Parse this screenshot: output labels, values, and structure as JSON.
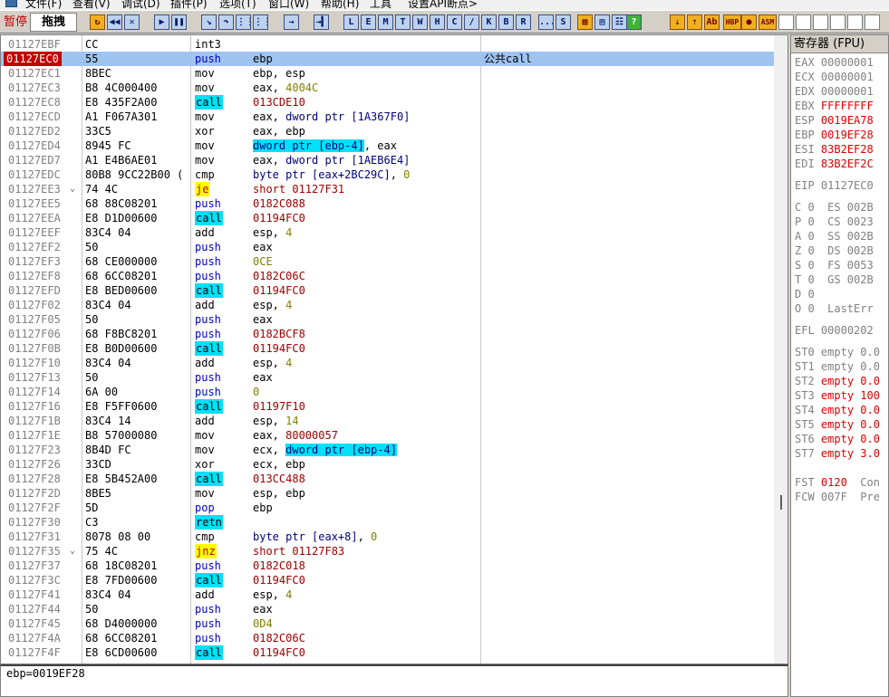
{
  "menu": [
    "文件(F)",
    "查看(V)",
    "调试(D)",
    "插件(P)",
    "选项(T)",
    "窗口(W)",
    "帮助(H)",
    "工具",
    "设置API断点>"
  ],
  "toolbar": {
    "status": "暂停",
    "module": "拖拽",
    "letters": [
      "L",
      "E",
      "M",
      "T",
      "W",
      "H",
      "C",
      "/",
      "K",
      "B",
      "R",
      "...",
      "S"
    ],
    "right_tools": [
      "HBP",
      "ASM"
    ]
  },
  "disasm": [
    {
      "addr": "01127EBF",
      "hex": "CC",
      "mn": "int3",
      "ops": [],
      "cm": "",
      "kind": "",
      "sel": false,
      "marker": ""
    },
    {
      "addr": "01127EC0",
      "hex": "55",
      "mn": "push",
      "ops": [
        {
          "t": "ebp"
        }
      ],
      "cm": "公共call",
      "kind": "push",
      "sel": true,
      "marker": ""
    },
    {
      "addr": "01127EC1",
      "hex": "8BEC",
      "mn": "mov",
      "ops": [
        {
          "t": "ebp, esp"
        }
      ],
      "cm": "",
      "kind": "",
      "sel": false,
      "marker": ""
    },
    {
      "addr": "01127EC3",
      "hex": "B8 4C000400",
      "mn": "mov",
      "ops": [
        {
          "t": "eax, "
        },
        {
          "t": "4004C",
          "c": "num"
        }
      ],
      "cm": "",
      "kind": "",
      "sel": false,
      "marker": ""
    },
    {
      "addr": "01127EC8",
      "hex": "E8 435F2A00",
      "mn": "call",
      "ops": [
        {
          "t": "013CDE10",
          "c": "addr"
        }
      ],
      "cm": "",
      "kind": "call",
      "sel": false,
      "marker": ""
    },
    {
      "addr": "01127ECD",
      "hex": "A1 F067A301",
      "mn": "mov",
      "ops": [
        {
          "t": "eax, "
        },
        {
          "t": "dword ptr [1A367F0]",
          "c": "mem"
        }
      ],
      "cm": "",
      "kind": "",
      "sel": false,
      "marker": ""
    },
    {
      "addr": "01127ED2",
      "hex": "33C5",
      "mn": "xor",
      "ops": [
        {
          "t": "eax, ebp"
        }
      ],
      "cm": "",
      "kind": "",
      "sel": false,
      "marker": ""
    },
    {
      "addr": "01127ED4",
      "hex": "8945 FC",
      "mn": "mov",
      "ops": [
        {
          "t": "dword ptr [ebp-4]",
          "c": "memhl"
        },
        {
          "t": ", eax"
        }
      ],
      "cm": "",
      "kind": "",
      "sel": false,
      "marker": ""
    },
    {
      "addr": "01127ED7",
      "hex": "A1 E4B6AE01",
      "mn": "mov",
      "ops": [
        {
          "t": "eax, "
        },
        {
          "t": "dword ptr [1AEB6E4]",
          "c": "mem"
        }
      ],
      "cm": "",
      "kind": "",
      "sel": false,
      "marker": ""
    },
    {
      "addr": "01127EDC",
      "hex": "80B8 9CC22B00 (",
      "mn": "cmp",
      "ops": [
        {
          "t": "byte ptr [eax+2BC29C]",
          "c": "mem"
        },
        {
          "t": ", "
        },
        {
          "t": "0",
          "c": "num"
        }
      ],
      "cm": "",
      "kind": "",
      "sel": false,
      "marker": ""
    },
    {
      "addr": "01127EE3",
      "hex": "74 4C",
      "mn": "je",
      "ops": [
        {
          "t": "short 01127F31",
          "c": "addr"
        }
      ],
      "cm": "",
      "kind": "jmp",
      "sel": false,
      "marker": "⌄"
    },
    {
      "addr": "01127EE5",
      "hex": "68 88C08201",
      "mn": "push",
      "ops": [
        {
          "t": "0182C088",
          "c": "addr"
        }
      ],
      "cm": "",
      "kind": "push",
      "sel": false,
      "marker": ""
    },
    {
      "addr": "01127EEA",
      "hex": "E8 D1D00600",
      "mn": "call",
      "ops": [
        {
          "t": "01194FC0",
          "c": "addr"
        }
      ],
      "cm": "",
      "kind": "call",
      "sel": false,
      "marker": ""
    },
    {
      "addr": "01127EEF",
      "hex": "83C4 04",
      "mn": "add",
      "ops": [
        {
          "t": "esp, "
        },
        {
          "t": "4",
          "c": "num"
        }
      ],
      "cm": "",
      "kind": "",
      "sel": false,
      "marker": ""
    },
    {
      "addr": "01127EF2",
      "hex": "50",
      "mn": "push",
      "ops": [
        {
          "t": "eax"
        }
      ],
      "cm": "",
      "kind": "push",
      "sel": false,
      "marker": ""
    },
    {
      "addr": "01127EF3",
      "hex": "68 CE000000",
      "mn": "push",
      "ops": [
        {
          "t": "0CE",
          "c": "num"
        }
      ],
      "cm": "",
      "kind": "push",
      "sel": false,
      "marker": ""
    },
    {
      "addr": "01127EF8",
      "hex": "68 6CC08201",
      "mn": "push",
      "ops": [
        {
          "t": "0182C06C",
          "c": "addr"
        }
      ],
      "cm": "",
      "kind": "push",
      "sel": false,
      "marker": ""
    },
    {
      "addr": "01127EFD",
      "hex": "E8 BED00600",
      "mn": "call",
      "ops": [
        {
          "t": "01194FC0",
          "c": "addr"
        }
      ],
      "cm": "",
      "kind": "call",
      "sel": false,
      "marker": ""
    },
    {
      "addr": "01127F02",
      "hex": "83C4 04",
      "mn": "add",
      "ops": [
        {
          "t": "esp, "
        },
        {
          "t": "4",
          "c": "num"
        }
      ],
      "cm": "",
      "kind": "",
      "sel": false,
      "marker": ""
    },
    {
      "addr": "01127F05",
      "hex": "50",
      "mn": "push",
      "ops": [
        {
          "t": "eax"
        }
      ],
      "cm": "",
      "kind": "push",
      "sel": false,
      "marker": ""
    },
    {
      "addr": "01127F06",
      "hex": "68 F8BC8201",
      "mn": "push",
      "ops": [
        {
          "t": "0182BCF8",
          "c": "addr"
        }
      ],
      "cm": "",
      "kind": "push",
      "sel": false,
      "marker": ""
    },
    {
      "addr": "01127F0B",
      "hex": "E8 B0D00600",
      "mn": "call",
      "ops": [
        {
          "t": "01194FC0",
          "c": "addr"
        }
      ],
      "cm": "",
      "kind": "call",
      "sel": false,
      "marker": ""
    },
    {
      "addr": "01127F10",
      "hex": "83C4 04",
      "mn": "add",
      "ops": [
        {
          "t": "esp, "
        },
        {
          "t": "4",
          "c": "num"
        }
      ],
      "cm": "",
      "kind": "",
      "sel": false,
      "marker": ""
    },
    {
      "addr": "01127F13",
      "hex": "50",
      "mn": "push",
      "ops": [
        {
          "t": "eax"
        }
      ],
      "cm": "",
      "kind": "push",
      "sel": false,
      "marker": ""
    },
    {
      "addr": "01127F14",
      "hex": "6A 00",
      "mn": "push",
      "ops": [
        {
          "t": "0",
          "c": "num"
        }
      ],
      "cm": "",
      "kind": "push",
      "sel": false,
      "marker": ""
    },
    {
      "addr": "01127F16",
      "hex": "E8 F5FF0600",
      "mn": "call",
      "ops": [
        {
          "t": "01197F10",
          "c": "addr"
        }
      ],
      "cm": "",
      "kind": "call",
      "sel": false,
      "marker": ""
    },
    {
      "addr": "01127F1B",
      "hex": "83C4 14",
      "mn": "add",
      "ops": [
        {
          "t": "esp, "
        },
        {
          "t": "14",
          "c": "num"
        }
      ],
      "cm": "",
      "kind": "",
      "sel": false,
      "marker": ""
    },
    {
      "addr": "01127F1E",
      "hex": "B8 57000080",
      "mn": "mov",
      "ops": [
        {
          "t": "eax, "
        },
        {
          "t": "80000057",
          "c": "addr"
        }
      ],
      "cm": "",
      "kind": "",
      "sel": false,
      "marker": ""
    },
    {
      "addr": "01127F23",
      "hex": "8B4D FC",
      "mn": "mov",
      "ops": [
        {
          "t": "ecx, "
        },
        {
          "t": "dword ptr [ebp-4]",
          "c": "memhl"
        }
      ],
      "cm": "",
      "kind": "",
      "sel": false,
      "marker": ""
    },
    {
      "addr": "01127F26",
      "hex": "33CD",
      "mn": "xor",
      "ops": [
        {
          "t": "ecx, ebp"
        }
      ],
      "cm": "",
      "kind": "",
      "sel": false,
      "marker": ""
    },
    {
      "addr": "01127F28",
      "hex": "E8 5B452A00",
      "mn": "call",
      "ops": [
        {
          "t": "013CC488",
          "c": "addr"
        }
      ],
      "cm": "",
      "kind": "call",
      "sel": false,
      "marker": ""
    },
    {
      "addr": "01127F2D",
      "hex": "8BE5",
      "mn": "mov",
      "ops": [
        {
          "t": "esp, ebp"
        }
      ],
      "cm": "",
      "kind": "",
      "sel": false,
      "marker": ""
    },
    {
      "addr": "01127F2F",
      "hex": "5D",
      "mn": "pop",
      "ops": [
        {
          "t": "ebp"
        }
      ],
      "cm": "",
      "kind": "pop",
      "sel": false,
      "marker": ""
    },
    {
      "addr": "01127F30",
      "hex": "C3",
      "mn": "retn",
      "ops": [],
      "cm": "",
      "kind": "ret",
      "sel": false,
      "marker": ""
    },
    {
      "addr": "01127F31",
      "hex": "8078 08 00",
      "mn": "cmp",
      "ops": [
        {
          "t": "byte ptr [eax+8]",
          "c": "mem"
        },
        {
          "t": ", "
        },
        {
          "t": "0",
          "c": "num"
        }
      ],
      "cm": "",
      "kind": "",
      "sel": false,
      "marker": ""
    },
    {
      "addr": "01127F35",
      "hex": "75 4C",
      "mn": "jnz",
      "ops": [
        {
          "t": "short 01127F83",
          "c": "addr"
        }
      ],
      "cm": "",
      "kind": "jmp",
      "sel": false,
      "marker": "⌄"
    },
    {
      "addr": "01127F37",
      "hex": "68 18C08201",
      "mn": "push",
      "ops": [
        {
          "t": "0182C018",
          "c": "addr"
        }
      ],
      "cm": "",
      "kind": "push",
      "sel": false,
      "marker": ""
    },
    {
      "addr": "01127F3C",
      "hex": "E8 7FD00600",
      "mn": "call",
      "ops": [
        {
          "t": "01194FC0",
          "c": "addr"
        }
      ],
      "cm": "",
      "kind": "call",
      "sel": false,
      "marker": ""
    },
    {
      "addr": "01127F41",
      "hex": "83C4 04",
      "mn": "add",
      "ops": [
        {
          "t": "esp, "
        },
        {
          "t": "4",
          "c": "num"
        }
      ],
      "cm": "",
      "kind": "",
      "sel": false,
      "marker": ""
    },
    {
      "addr": "01127F44",
      "hex": "50",
      "mn": "push",
      "ops": [
        {
          "t": "eax"
        }
      ],
      "cm": "",
      "kind": "push",
      "sel": false,
      "marker": ""
    },
    {
      "addr": "01127F45",
      "hex": "68 D4000000",
      "mn": "push",
      "ops": [
        {
          "t": "0D4",
          "c": "num"
        }
      ],
      "cm": "",
      "kind": "push",
      "sel": false,
      "marker": ""
    },
    {
      "addr": "01127F4A",
      "hex": "68 6CC08201",
      "mn": "push",
      "ops": [
        {
          "t": "0182C06C",
          "c": "addr"
        }
      ],
      "cm": "",
      "kind": "push",
      "sel": false,
      "marker": ""
    },
    {
      "addr": "01127F4F",
      "hex": "E8 6CD00600",
      "mn": "call",
      "ops": [
        {
          "t": "01194FC0",
          "c": "addr"
        }
      ],
      "cm": "",
      "kind": "call",
      "sel": false,
      "marker": ""
    }
  ],
  "info_line": "ebp=0019EF28",
  "registers": {
    "title": "寄存器 (FPU)",
    "gp": [
      {
        "name": "EAX",
        "value": "00000001",
        "changed": false
      },
      {
        "name": "ECX",
        "value": "00000001",
        "changed": false
      },
      {
        "name": "EDX",
        "value": "00000001",
        "changed": false
      },
      {
        "name": "EBX",
        "value": "FFFFFFFF",
        "changed": true
      },
      {
        "name": "ESP",
        "value": "0019EA78",
        "changed": true
      },
      {
        "name": "EBP",
        "value": "0019EF28",
        "changed": true
      },
      {
        "name": "ESI",
        "value": "83B2EF28",
        "changed": true
      },
      {
        "name": "EDI",
        "value": "83B2EF2C",
        "changed": true
      }
    ],
    "eip": {
      "name": "EIP",
      "value": "01127EC0"
    },
    "flags": [
      "C 0  ES 002B",
      "P 0  CS 0023",
      "A 0  SS 002B",
      "Z 0  DS 002B",
      "S 0  FS 0053",
      "T 0  GS 002B",
      "D 0",
      "O 0  LastErr"
    ],
    "efl": {
      "name": "EFL",
      "value": "00000202"
    },
    "fpu": [
      {
        "name": "ST0",
        "value": "empty 0.0",
        "changed": false
      },
      {
        "name": "ST1",
        "value": "empty 0.0",
        "changed": false
      },
      {
        "name": "ST2",
        "value": "empty 0.0",
        "changed": true
      },
      {
        "name": "ST3",
        "value": "empty 100",
        "changed": true
      },
      {
        "name": "ST4",
        "value": "empty 0.0",
        "changed": true
      },
      {
        "name": "ST5",
        "value": "empty 0.0",
        "changed": true
      },
      {
        "name": "ST6",
        "value": "empty 0.0",
        "changed": true
      },
      {
        "name": "ST7",
        "value": "empty 3.0",
        "changed": true
      }
    ],
    "fst": {
      "name": "FST",
      "value": "0120",
      "suffix": "Con"
    },
    "fcw": {
      "name": "FCW",
      "value": "007F",
      "suffix": "Pre"
    }
  }
}
